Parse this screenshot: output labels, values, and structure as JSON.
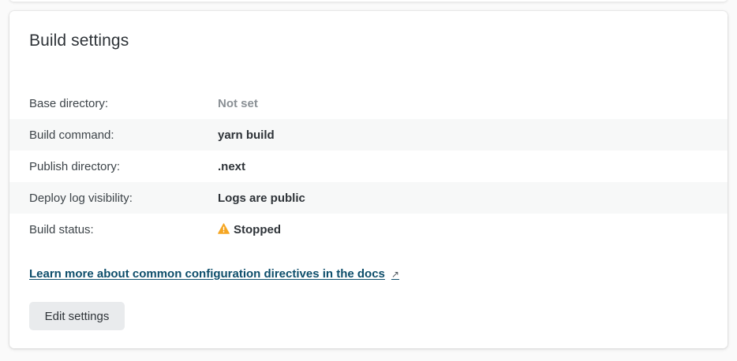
{
  "card": {
    "title": "Build settings"
  },
  "settings": [
    {
      "label": "Base directory:",
      "value": "Not set"
    },
    {
      "label": "Build command:",
      "value": "yarn build"
    },
    {
      "label": "Publish directory:",
      "value": ".next"
    },
    {
      "label": "Deploy log visibility:",
      "value": "Logs are public"
    },
    {
      "label": "Build status:",
      "value": "Stopped",
      "icon": "warning-icon"
    }
  ],
  "docs_link": {
    "text": "Learn more about common configuration directives in the docs",
    "icon": "external-link-icon"
  },
  "edit_button": {
    "label": "Edit settings"
  },
  "colors": {
    "warning": "#f5a623",
    "link": "#0e4e6b",
    "muted": "#8a9095"
  }
}
